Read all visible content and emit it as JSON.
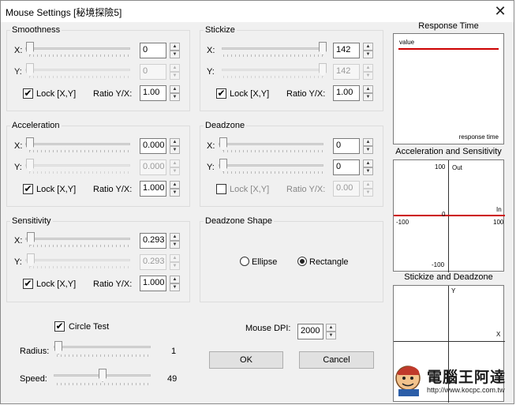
{
  "window": {
    "title": "Mouse Settings [秘境探險5]"
  },
  "smoothness": {
    "title": "Smoothness",
    "x_label": "X:",
    "y_label": "Y:",
    "x_value": "0",
    "y_value": "0",
    "x_level": 0,
    "y_level": 0,
    "lock_label": "Lock [X,Y]",
    "lock_checked": true,
    "ratio_label": "Ratio Y/X:",
    "ratio_value": "1.00"
  },
  "stickize": {
    "title": "Stickize",
    "x_label": "X:",
    "y_label": "Y:",
    "x_value": "142",
    "y_value": "142",
    "x_level": 1,
    "y_level": 1,
    "lock_label": "Lock [X,Y]",
    "lock_checked": true,
    "ratio_label": "Ratio Y/X:",
    "ratio_value": "1.00"
  },
  "acceleration": {
    "title": "Acceleration",
    "x_label": "X:",
    "y_label": "Y:",
    "x_value": "0.000",
    "y_value": "0.000",
    "x_level": 0,
    "y_level": 0,
    "lock_label": "Lock [X,Y]",
    "lock_checked": true,
    "ratio_label": "Ratio Y/X:",
    "ratio_value": "1.000"
  },
  "deadzone": {
    "title": "Deadzone",
    "x_label": "X:",
    "y_label": "Y:",
    "x_value": "0",
    "y_value": "0",
    "x_level": 0,
    "y_level": 0,
    "lock_label": "Lock [X,Y]",
    "lock_checked": false,
    "ratio_label": "Ratio Y/X:",
    "ratio_value": "0.00"
  },
  "sensitivity": {
    "title": "Sensitivity",
    "x_label": "X:",
    "y_label": "Y:",
    "x_value": "0.293",
    "y_value": "0.293",
    "x_level": 0,
    "y_level": 0,
    "lock_label": "Lock [X,Y]",
    "lock_checked": true,
    "ratio_label": "Ratio Y/X:",
    "ratio_value": "1.000"
  },
  "deadzone_shape": {
    "title": "Deadzone Shape",
    "ellipse_label": "Ellipse",
    "rectangle_label": "Rectangle",
    "selected": "Rectangle"
  },
  "circle_test": {
    "label": "Circle Test",
    "checked": true,
    "radius_label": "Radius:",
    "radius_value": "1",
    "radius_level": 0,
    "speed_label": "Speed:",
    "speed_value": "49",
    "speed_level": 0.49
  },
  "dpi": {
    "label": "Mouse DPI:",
    "value": "2000"
  },
  "buttons": {
    "ok": "OK",
    "cancel": "Cancel"
  },
  "response_time": {
    "title": "Response Time",
    "y_label": "value",
    "x_label": "response time",
    "line_color": "#cc0000"
  },
  "accel_graph": {
    "title": "Acceleration and Sensitivity",
    "y_max": "100",
    "y_min": "-100",
    "x_min": "-100",
    "x_max": "100",
    "origin": "0",
    "y_axis_label": "Out",
    "x_axis_label": "In",
    "line_color": "#cc0000"
  },
  "stick_graph": {
    "title": "Stickize and Deadzone",
    "y_label": "Y",
    "x_label": "X"
  },
  "watermark": {
    "brand": "電腦王阿達",
    "url": "http://www.kocpc.com.tw"
  }
}
